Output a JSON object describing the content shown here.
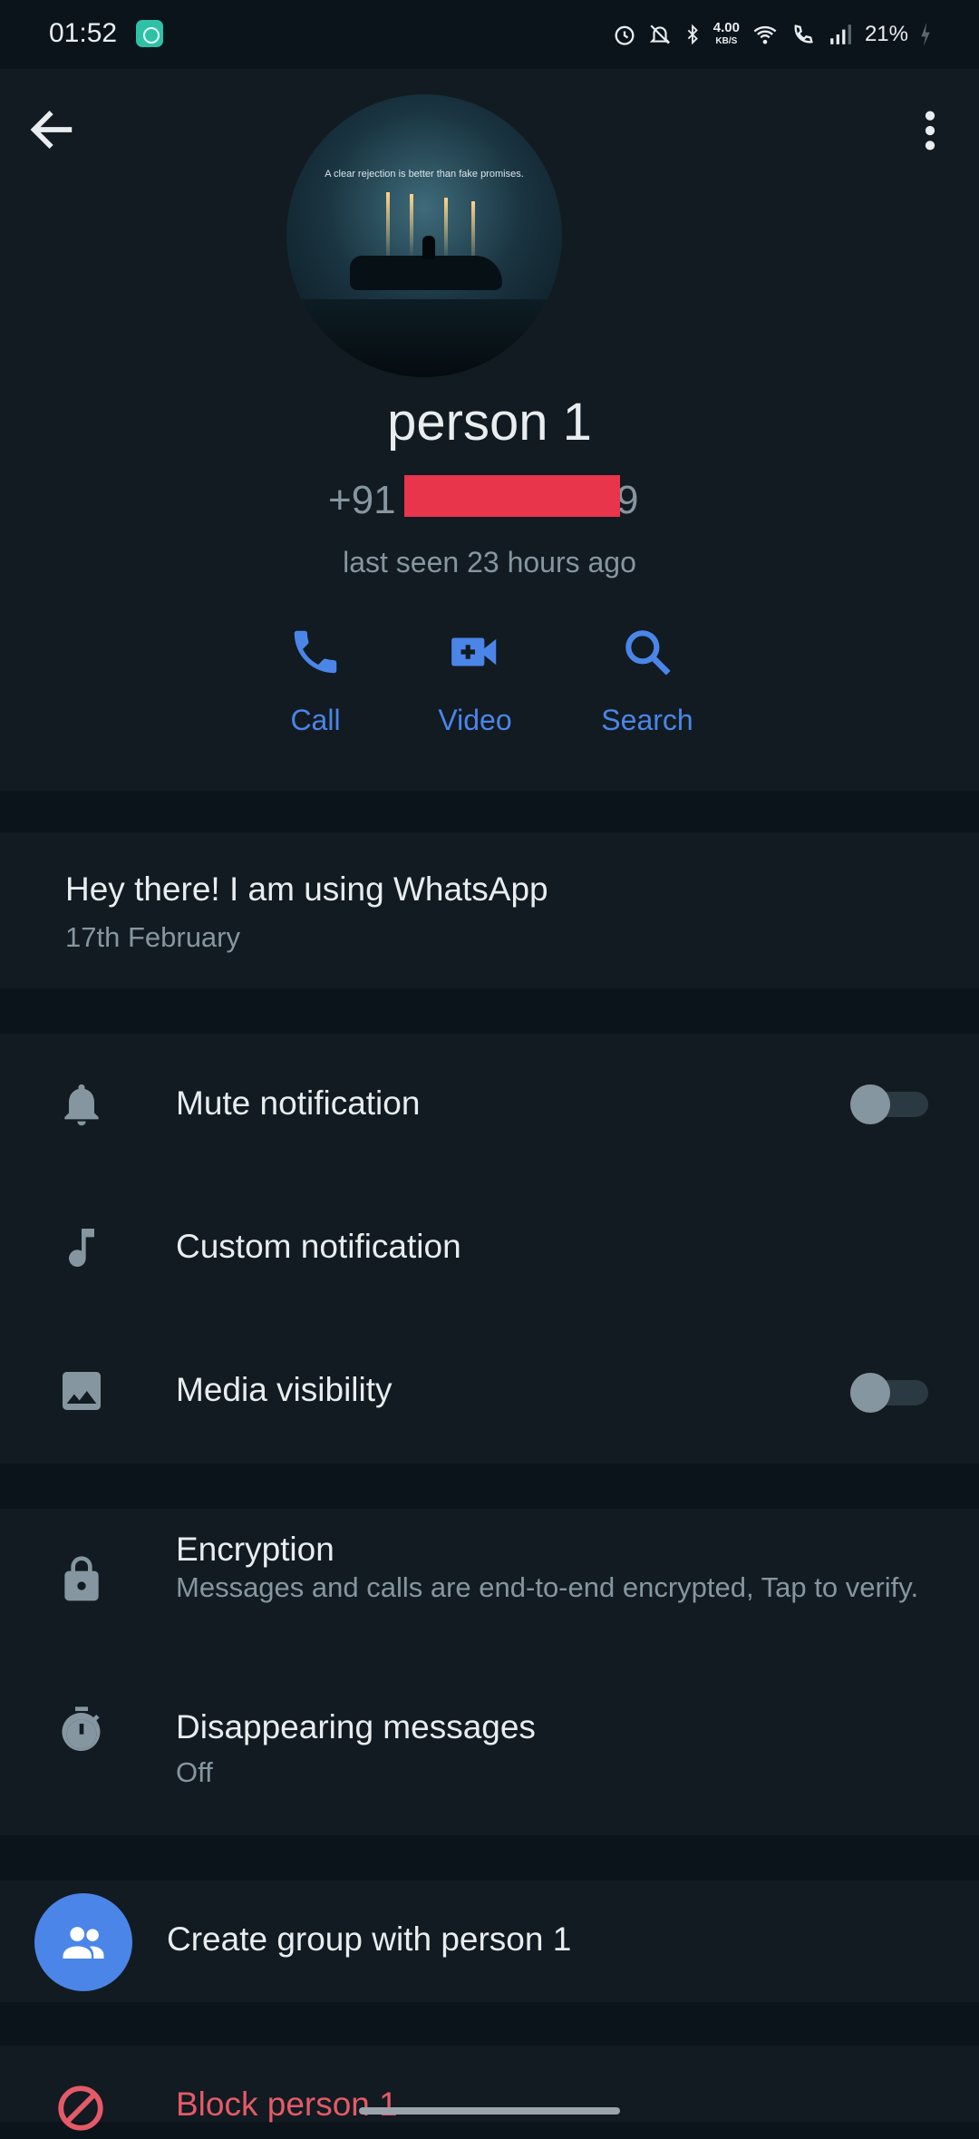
{
  "status_bar": {
    "time": "01:52",
    "net_speed_value": "4.00",
    "net_speed_unit": "KB/S",
    "battery": "21%"
  },
  "contact": {
    "name": "person 1",
    "phone_prefix": "+91",
    "phone_suffix": "9",
    "last_seen": "last seen 23 hours ago",
    "avatar_caption": "A clear rejection is better than fake promises."
  },
  "actions": [
    {
      "label": "Call",
      "icon": "phone-icon"
    },
    {
      "label": "Video",
      "icon": "video-icon"
    },
    {
      "label": "Search",
      "icon": "search-icon"
    }
  ],
  "about": {
    "text": "Hey there! I am using WhatsApp",
    "date": "17th February"
  },
  "settings": {
    "mute": {
      "label": "Mute notification",
      "icon": "bell-icon",
      "enabled": false
    },
    "custom": {
      "label": "Custom notification",
      "icon": "music-note-icon"
    },
    "media": {
      "label": "Media visibility",
      "icon": "image-icon",
      "enabled": false
    }
  },
  "security": {
    "encryption": {
      "label": "Encryption",
      "sub": "Messages and calls are end-to-end encrypted, Tap to verify.",
      "icon": "lock-icon"
    },
    "disappearing": {
      "label": "Disappearing messages",
      "sub": "Off",
      "icon": "timer-icon"
    }
  },
  "group": {
    "label": "Create group with person 1",
    "icon": "group-icon"
  },
  "block": {
    "label": "Block person 1",
    "icon": "block-icon"
  },
  "colors": {
    "accent": "#4b85e8",
    "danger": "#e55a68",
    "redaction": "#e9354c"
  }
}
